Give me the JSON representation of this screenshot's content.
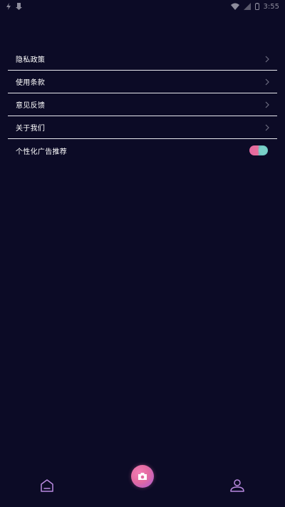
{
  "status_bar": {
    "time": "3:55"
  },
  "menu": {
    "items": [
      {
        "label": "隐私政策"
      },
      {
        "label": "使用条款"
      },
      {
        "label": "意见反馈"
      },
      {
        "label": "关于我们"
      }
    ],
    "toggle_item": {
      "label": "个性化广告推荐",
      "enabled": true
    }
  },
  "colors": {
    "background": "#0c0b26",
    "accent_pink": "#e2689f",
    "accent_teal": "#6cc3c0",
    "tab_icon": "#b98ae0"
  },
  "tabbar": {
    "icons": [
      "home-icon",
      "camera-icon",
      "profile-icon"
    ]
  }
}
